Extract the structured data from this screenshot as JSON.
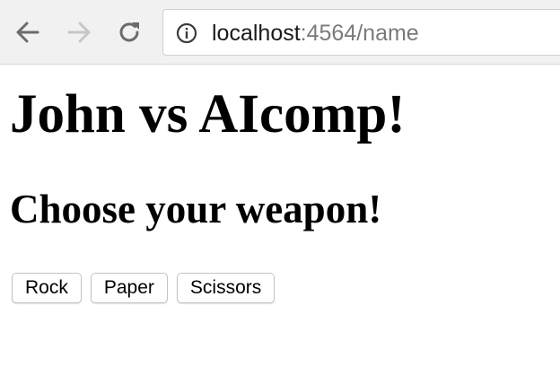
{
  "browser": {
    "url_host": "localhost",
    "url_rest": ":4564/name",
    "icons": {
      "back": "back-arrow-icon",
      "forward": "forward-arrow-icon",
      "reload": "reload-icon",
      "info": "info-icon"
    }
  },
  "page": {
    "title": "John vs AIcomp!",
    "subtitle": "Choose your weapon!",
    "buttons": [
      {
        "label": "Rock"
      },
      {
        "label": "Paper"
      },
      {
        "label": "Scissors"
      }
    ]
  }
}
